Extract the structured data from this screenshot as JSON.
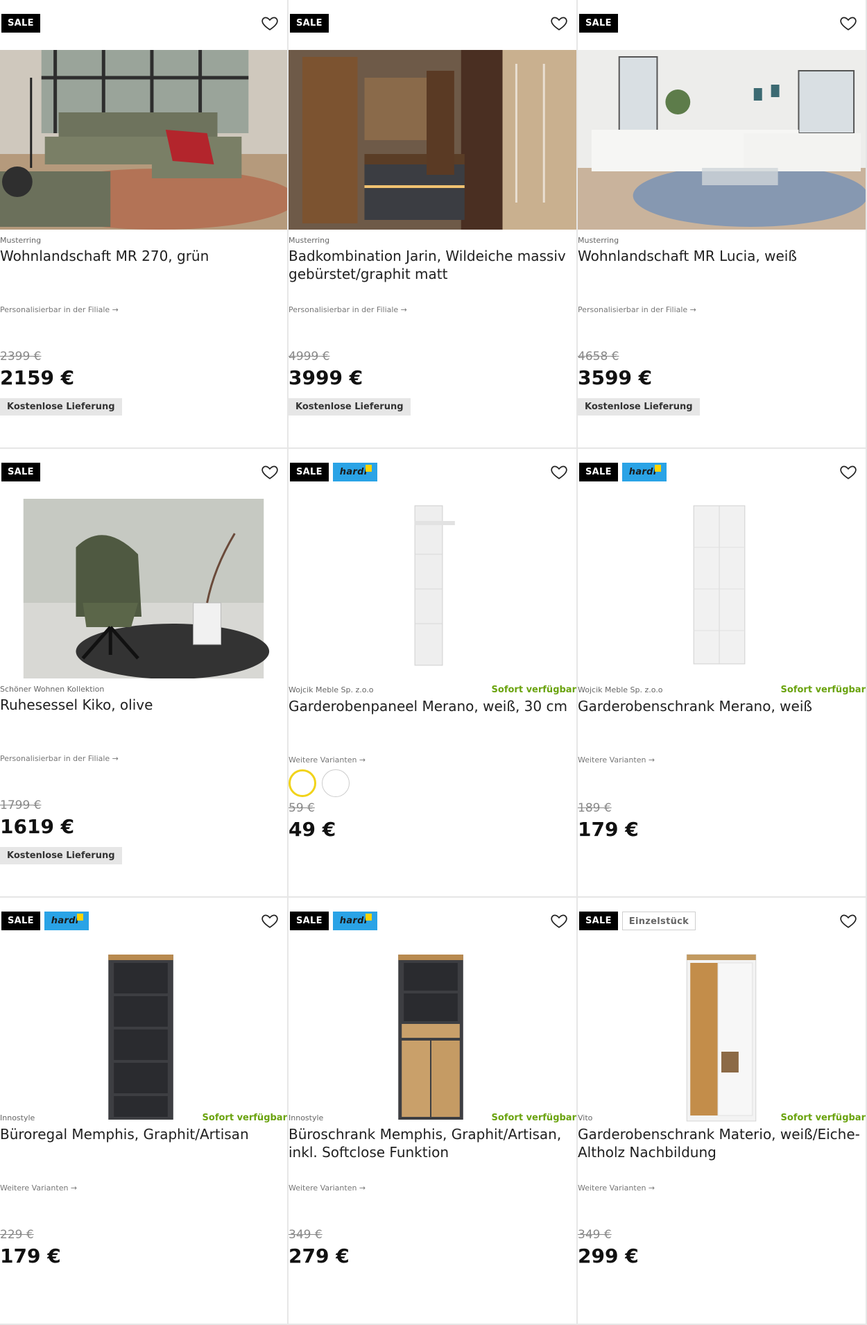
{
  "products": [
    {
      "badges": [
        "SALE"
      ],
      "brand": "Musterring",
      "title": "Wohnlandschaft MR 270, grün",
      "link": "Personalisierbar in der Filiale →",
      "old_price": "2399 €",
      "price": "2159 €",
      "shipping": "Kostenlose Lieferung",
      "availability": "",
      "image": "green-sofa-living-room"
    },
    {
      "badges": [
        "SALE"
      ],
      "brand": "Musterring",
      "title": "Badkombination Jarin, Wildeiche massiv gebürstet/graphit matt",
      "link": "Personalisierbar in der Filiale →",
      "old_price": "4999 €",
      "price": "3999 €",
      "shipping": "Kostenlose Lieferung",
      "availability": "",
      "image": "bathroom-furniture"
    },
    {
      "badges": [
        "SALE"
      ],
      "brand": "Musterring",
      "title": "Wohnlandschaft MR Lucia, weiß",
      "link": "Personalisierbar in der Filiale →",
      "old_price": "4658 €",
      "price": "3599 €",
      "shipping": "Kostenlose Lieferung",
      "availability": "",
      "image": "white-sofa-living-room"
    },
    {
      "badges": [
        "SALE"
      ],
      "brand": "Schöner Wohnen Kollektion",
      "title": "Ruhesessel Kiko, olive",
      "link": "Personalisierbar in der Filiale →",
      "old_price": "1799 €",
      "price": "1619 €",
      "shipping": "Kostenlose Lieferung",
      "availability": "",
      "image": "olive-armchair"
    },
    {
      "badges": [
        "SALE",
        "hardi"
      ],
      "brand": "Wojcik Meble Sp. z.o.o",
      "title": "Garderobenpaneel Merano, weiß, 30 cm",
      "link": "Weitere Varianten →",
      "old_price": "59 €",
      "price": "49 €",
      "shipping": "",
      "availability": "Sofort verfügbar",
      "image": "white-wall-panel"
    },
    {
      "badges": [
        "SALE",
        "hardi"
      ],
      "brand": "Wojcik Meble Sp. z.o.o",
      "title": "Garderobenschrank Merano, weiß",
      "link": "Weitere Varianten →",
      "old_price": "189 €",
      "price": "179 €",
      "shipping": "",
      "availability": "Sofort verfügbar",
      "image": "white-wardrobe"
    },
    {
      "badges": [
        "SALE",
        "hardi"
      ],
      "brand": "Innostyle",
      "title": "Büroregal Memphis, Graphit/Artisan",
      "link": "Weitere Varianten →",
      "old_price": "229 €",
      "price": "179 €",
      "shipping": "",
      "availability": "Sofort verfügbar",
      "image": "graphite-shelf"
    },
    {
      "badges": [
        "SALE",
        "hardi"
      ],
      "brand": "Innostyle",
      "title": "Büroschrank Memphis, Graphit/Artisan, inkl. Softclose Funktion",
      "link": "Weitere Varianten →",
      "old_price": "349 €",
      "price": "279 €",
      "shipping": "",
      "availability": "Sofort verfügbar",
      "image": "graphite-cabinet"
    },
    {
      "badges": [
        "SALE",
        "Einzelstück"
      ],
      "brand": "Vito",
      "title": "Garderobenschrank Materio, weiß/Eiche-Altholz Nachbildung",
      "link": "Weitere Varianten →",
      "old_price": "349 €",
      "price": "299 €",
      "shipping": "",
      "availability": "Sofort verfügbar",
      "image": "white-oak-wardrobe"
    }
  ],
  "colors": {
    "sale_badge": "#000000",
    "hardi_badge": "#2aa3e6",
    "availability": "#6aa30e",
    "swatch_active": "#f1d31a"
  },
  "icons": {
    "favorite": "heart-outline-icon"
  }
}
